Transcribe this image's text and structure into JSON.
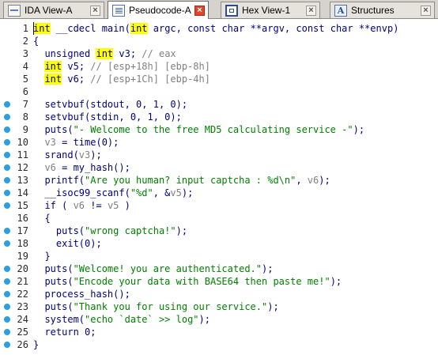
{
  "tabs": [
    {
      "label": "IDA View-A",
      "icon": "ida-view-icon",
      "active": false
    },
    {
      "label": "Pseudocode-A",
      "icon": "pseudocode-icon",
      "active": true
    },
    {
      "label": "Hex View-1",
      "icon": "hex-view-icon",
      "active": false
    },
    {
      "label": "Structures",
      "icon": "structures-icon",
      "active": false
    }
  ],
  "close_glyph": "×",
  "colors": {
    "highlight": "#ffff00",
    "code": "#000080",
    "comment": "#808080",
    "string": "#008000",
    "breakpoint_dot": "#2f9ee0",
    "active_close": "#e8432a"
  },
  "code_lines": [
    {
      "num": "1",
      "dot": false,
      "segs": [
        [
          "kw",
          "int"
        ],
        [
          "c",
          " __cdecl main("
        ],
        [
          "kw",
          "int"
        ],
        [
          "c",
          " argc, const char **argv, const char **envp)"
        ]
      ]
    },
    {
      "num": "2",
      "dot": false,
      "segs": [
        [
          "c",
          "{"
        ]
      ]
    },
    {
      "num": "3",
      "dot": false,
      "segs": [
        [
          "c",
          "  unsigned "
        ],
        [
          "kw",
          "int"
        ],
        [
          "c",
          " v3; "
        ],
        [
          "cm",
          "// eax"
        ]
      ]
    },
    {
      "num": "4",
      "dot": false,
      "segs": [
        [
          "c",
          "  "
        ],
        [
          "kw",
          "int"
        ],
        [
          "c",
          " v5; "
        ],
        [
          "cm",
          "// [esp+18h] [ebp-8h]"
        ]
      ]
    },
    {
      "num": "5",
      "dot": false,
      "segs": [
        [
          "c",
          "  "
        ],
        [
          "kw",
          "int"
        ],
        [
          "c",
          " v6; "
        ],
        [
          "cm",
          "// [esp+1Ch] [ebp-4h]"
        ]
      ]
    },
    {
      "num": "6",
      "dot": false,
      "segs": []
    },
    {
      "num": "7",
      "dot": true,
      "segs": [
        [
          "c",
          "  setvbuf(stdout, 0, 1, 0);"
        ]
      ]
    },
    {
      "num": "8",
      "dot": true,
      "segs": [
        [
          "c",
          "  setvbuf(stdin, 0, 1, 0);"
        ]
      ]
    },
    {
      "num": "9",
      "dot": true,
      "segs": [
        [
          "c",
          "  puts("
        ],
        [
          "str",
          "\"- Welcome to the free MD5 calculating service -\""
        ],
        [
          "c",
          ");"
        ]
      ]
    },
    {
      "num": "10",
      "dot": true,
      "segs": [
        [
          "c",
          "  "
        ],
        [
          "lv",
          "v3"
        ],
        [
          "c",
          " = time(0);"
        ]
      ]
    },
    {
      "num": "11",
      "dot": true,
      "segs": [
        [
          "c",
          "  srand("
        ],
        [
          "lv",
          "v3"
        ],
        [
          "c",
          ");"
        ]
      ]
    },
    {
      "num": "12",
      "dot": true,
      "segs": [
        [
          "c",
          "  "
        ],
        [
          "lv",
          "v6"
        ],
        [
          "c",
          " = my_hash();"
        ]
      ]
    },
    {
      "num": "13",
      "dot": true,
      "segs": [
        [
          "c",
          "  printf("
        ],
        [
          "str",
          "\"Are you human? input captcha : %d\\n\""
        ],
        [
          "c",
          ", "
        ],
        [
          "lv",
          "v6"
        ],
        [
          "c",
          ");"
        ]
      ]
    },
    {
      "num": "14",
      "dot": true,
      "segs": [
        [
          "c",
          "  __isoc99_scanf("
        ],
        [
          "str",
          "\"%d\""
        ],
        [
          "c",
          ", &"
        ],
        [
          "lv",
          "v5"
        ],
        [
          "c",
          ");"
        ]
      ]
    },
    {
      "num": "15",
      "dot": true,
      "segs": [
        [
          "c",
          "  if ( "
        ],
        [
          "lv",
          "v6"
        ],
        [
          "c",
          " != "
        ],
        [
          "lv",
          "v5"
        ],
        [
          "c",
          " )"
        ]
      ]
    },
    {
      "num": "16",
      "dot": false,
      "segs": [
        [
          "c",
          "  {"
        ]
      ]
    },
    {
      "num": "17",
      "dot": true,
      "segs": [
        [
          "c",
          "    puts("
        ],
        [
          "str",
          "\"wrong captcha!\""
        ],
        [
          "c",
          ");"
        ]
      ]
    },
    {
      "num": "18",
      "dot": true,
      "segs": [
        [
          "c",
          "    exit(0);"
        ]
      ]
    },
    {
      "num": "19",
      "dot": false,
      "segs": [
        [
          "c",
          "  }"
        ]
      ]
    },
    {
      "num": "20",
      "dot": true,
      "segs": [
        [
          "c",
          "  puts("
        ],
        [
          "str",
          "\"Welcome! you are authenticated.\""
        ],
        [
          "c",
          ");"
        ]
      ]
    },
    {
      "num": "21",
      "dot": true,
      "segs": [
        [
          "c",
          "  puts("
        ],
        [
          "str",
          "\"Encode your data with BASE64 then paste me!\""
        ],
        [
          "c",
          ");"
        ]
      ]
    },
    {
      "num": "22",
      "dot": true,
      "segs": [
        [
          "c",
          "  process_hash();"
        ]
      ]
    },
    {
      "num": "23",
      "dot": true,
      "segs": [
        [
          "c",
          "  puts("
        ],
        [
          "str",
          "\"Thank you for using our service.\""
        ],
        [
          "c",
          ");"
        ]
      ]
    },
    {
      "num": "24",
      "dot": true,
      "segs": [
        [
          "c",
          "  system("
        ],
        [
          "str",
          "\"echo `date` >> log\""
        ],
        [
          "c",
          ");"
        ]
      ]
    },
    {
      "num": "25",
      "dot": true,
      "segs": [
        [
          "c",
          "  return 0;"
        ]
      ]
    },
    {
      "num": "26",
      "dot": true,
      "segs": [
        [
          "c",
          "}"
        ]
      ]
    }
  ]
}
